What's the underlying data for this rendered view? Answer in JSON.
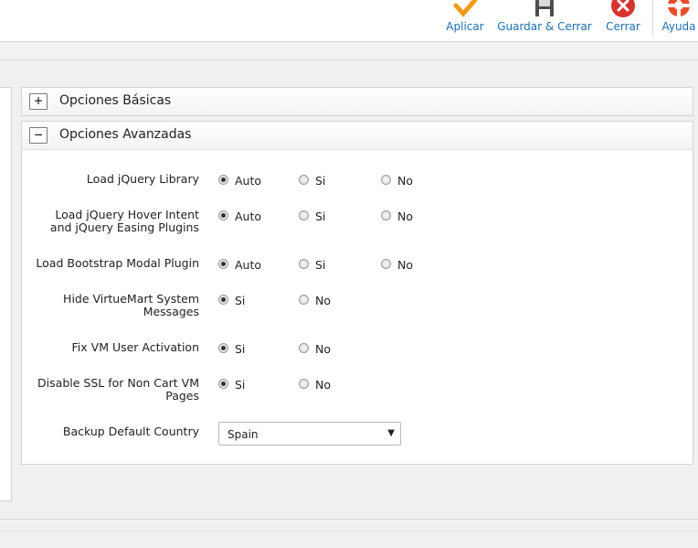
{
  "toolbar": {
    "apply_label": "Aplicar",
    "save_close_label": "Guardar & Cerrar",
    "close_label": "Cerrar",
    "help_label": "Ayuda",
    "apply_icon": "checkmark-icon",
    "save_icon": "floppy-disk-icon",
    "close_icon": "red-x-icon",
    "help_icon": "lifebuoy-icon"
  },
  "accordion": {
    "basic": {
      "title": "Opciones Básicas",
      "toggle": "+"
    },
    "advanced": {
      "title": "Opciones Avanzadas",
      "toggle": "−"
    }
  },
  "options": {
    "jquery": {
      "label": "Load jQuery Library",
      "choices": [
        "Auto",
        "Si",
        "No"
      ],
      "selected": "Auto"
    },
    "hover": {
      "label_line1": "Load jQuery Hover Intent",
      "label_line2": "and jQuery Easing Plugins",
      "choices": [
        "Auto",
        "Si",
        "No"
      ],
      "selected": "Auto"
    },
    "bootstrap": {
      "label": "Load Bootstrap Modal Plugin",
      "choices": [
        "Auto",
        "Si",
        "No"
      ],
      "selected": "Auto"
    },
    "hide_vm": {
      "label_line1": "Hide VirtueMart System",
      "label_line2": "Messages",
      "choices": [
        "Si",
        "No"
      ],
      "selected": "Si"
    },
    "fix_vm": {
      "label": "Fix VM User Activation",
      "choices": [
        "Si",
        "No"
      ],
      "selected": "Si"
    },
    "ssl": {
      "label_line1": "Disable SSL for Non Cart VM",
      "label_line2": "Pages",
      "choices": [
        "Si",
        "No"
      ],
      "selected": "Si"
    },
    "country": {
      "label": "Backup Default Country",
      "value": "Spain"
    }
  },
  "colors": {
    "toolbar_link": "#1b6fb0",
    "apply_orange": "#f29a1c",
    "close_red": "#d9332e"
  }
}
